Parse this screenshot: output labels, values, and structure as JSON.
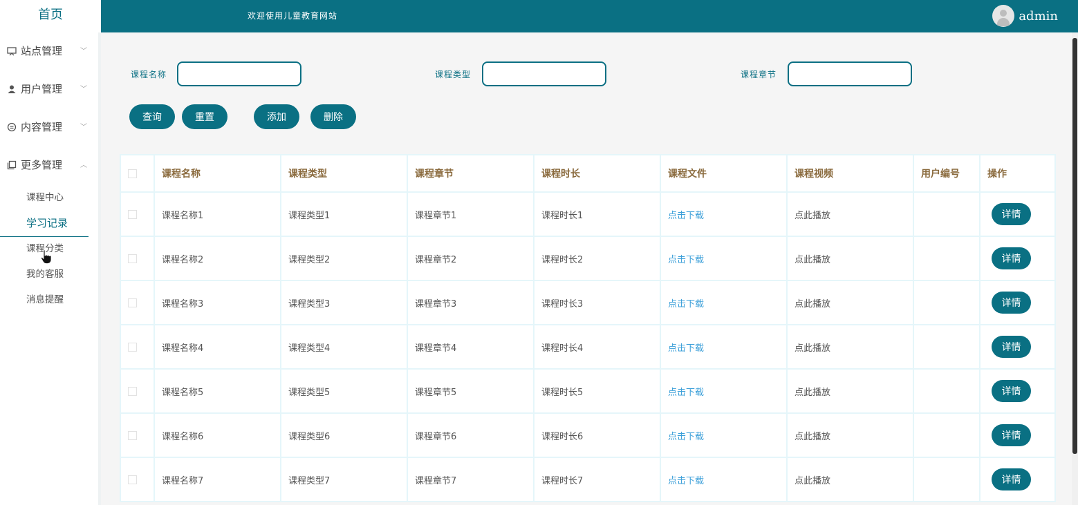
{
  "sidebar": {
    "home": "首页",
    "menus": [
      {
        "label": "站点管理",
        "icon": "monitor-icon",
        "arrow": "﹀"
      },
      {
        "label": "用户管理",
        "icon": "user-icon",
        "arrow": "﹀"
      },
      {
        "label": "内容管理",
        "icon": "message-icon",
        "arrow": "﹀"
      },
      {
        "label": "更多管理",
        "icon": "copy-icon",
        "arrow": "︿"
      }
    ],
    "sub_items": [
      "课程中心",
      "学习记录",
      "课程分类",
      "我的客服",
      "消息提醒"
    ],
    "active_sub": "学习记录"
  },
  "header": {
    "welcome": "欢迎使用儿童教育网站",
    "username": "admin"
  },
  "search": {
    "course_name_label": "课程名称",
    "course_type_label": "课程类型",
    "course_chapter_label": "课程章节",
    "course_name_value": "",
    "course_type_value": "",
    "course_chapter_value": ""
  },
  "toolbar": {
    "query": "查询",
    "reset": "重置",
    "add": "添加",
    "delete": "删除"
  },
  "table": {
    "headers": [
      "课程名称",
      "课程类型",
      "课程章节",
      "课程时长",
      "课程文件",
      "课程视频",
      "用户编号",
      "操作"
    ],
    "rows": [
      {
        "name": "课程名称1",
        "type": "课程类型1",
        "chapter": "课程章节1",
        "duration": "课程时长1",
        "file": "点击下载",
        "video": "点此播放",
        "user_no": "",
        "action": "详情"
      },
      {
        "name": "课程名称2",
        "type": "课程类型2",
        "chapter": "课程章节2",
        "duration": "课程时长2",
        "file": "点击下载",
        "video": "点此播放",
        "user_no": "",
        "action": "详情"
      },
      {
        "name": "课程名称3",
        "type": "课程类型3",
        "chapter": "课程章节3",
        "duration": "课程时长3",
        "file": "点击下载",
        "video": "点此播放",
        "user_no": "",
        "action": "详情"
      },
      {
        "name": "课程名称4",
        "type": "课程类型4",
        "chapter": "课程章节4",
        "duration": "课程时长4",
        "file": "点击下载",
        "video": "点此播放",
        "user_no": "",
        "action": "详情"
      },
      {
        "name": "课程名称5",
        "type": "课程类型5",
        "chapter": "课程章节5",
        "duration": "课程时长5",
        "file": "点击下载",
        "video": "点此播放",
        "user_no": "",
        "action": "详情"
      },
      {
        "name": "课程名称6",
        "type": "课程类型6",
        "chapter": "课程章节6",
        "duration": "课程时长6",
        "file": "点击下载",
        "video": "点此播放",
        "user_no": "",
        "action": "详情"
      },
      {
        "name": "课程名称7",
        "type": "课程类型7",
        "chapter": "课程章节7",
        "duration": "课程时长7",
        "file": "点击下载",
        "video": "点此播放",
        "user_no": "",
        "action": "详情"
      }
    ]
  },
  "colors": {
    "primary": "#0a7083",
    "header_text": "#8a6a3d",
    "link": "#3b9fd9"
  }
}
